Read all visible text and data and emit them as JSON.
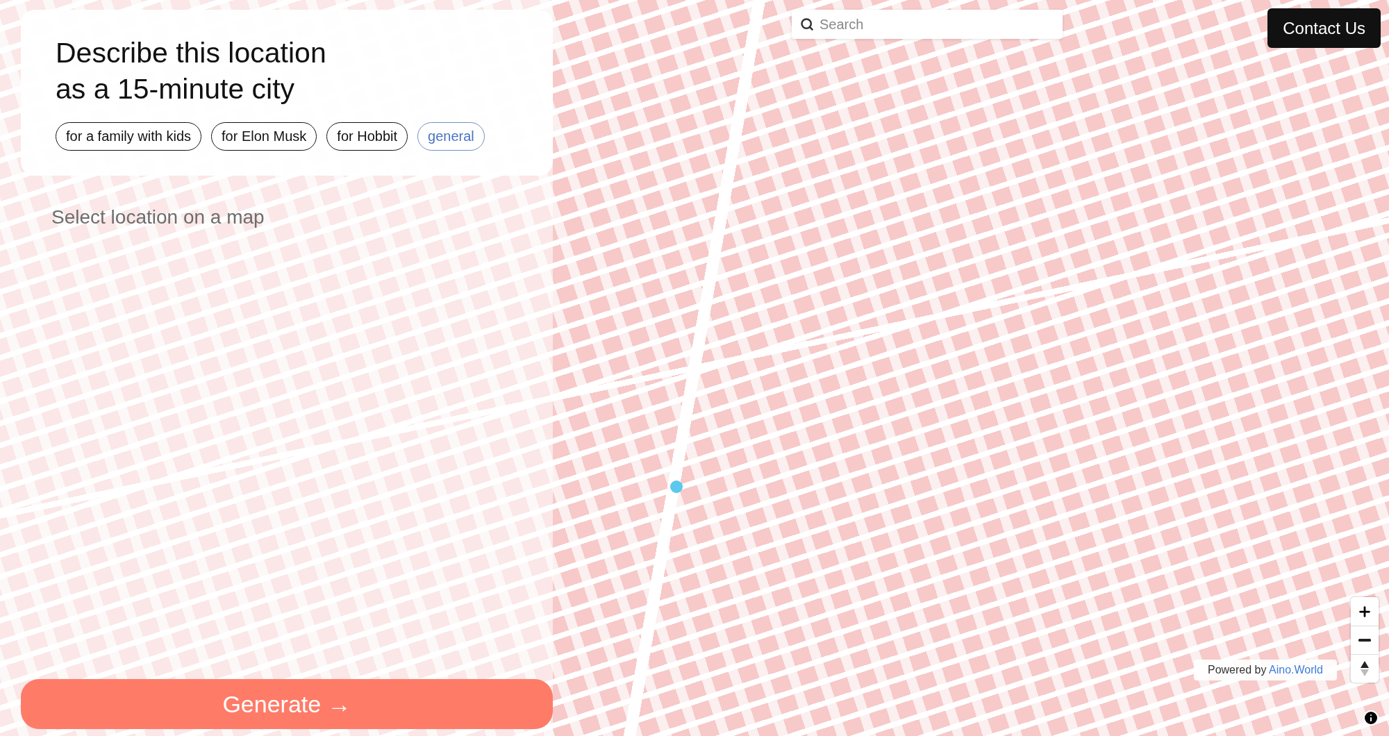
{
  "prompt_panel": {
    "title_lines": [
      "Describe this location",
      "as a 15-minute city"
    ],
    "personas": [
      {
        "label": "for a family with kids",
        "selected": false
      },
      {
        "label": "for Elon Musk",
        "selected": false
      },
      {
        "label": "for Hobbit",
        "selected": false
      },
      {
        "label": "general",
        "selected": true
      }
    ]
  },
  "location_hint": "Select location on a map",
  "generate_button": "Generate →",
  "search": {
    "placeholder": "Search"
  },
  "contact_button": "Contact Us",
  "map_controls": [
    {
      "kind": "zoom-in"
    },
    {
      "kind": "zoom-out"
    },
    {
      "kind": "compass"
    }
  ],
  "attribution": {
    "prefix": "Powered by",
    "link": "Aino.World"
  }
}
